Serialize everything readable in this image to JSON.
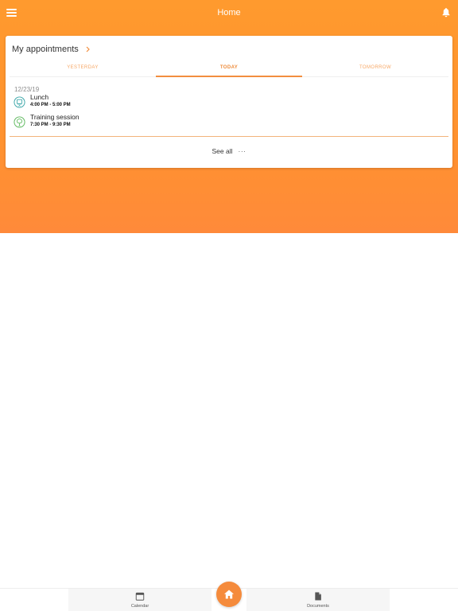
{
  "header": {
    "title": "Home",
    "menu_icon": "hamburger-menu-icon",
    "notifications_icon": "bell-icon"
  },
  "colors": {
    "accent": "#ff922f",
    "tab_active": "#ee8b3a",
    "tab_inactive": "#f7a765",
    "divider": "#f3b37b",
    "icon_teal": "#3aa6a8",
    "icon_green": "#5cb85c"
  },
  "appointments_card": {
    "title": "My appointments",
    "tabs": [
      {
        "label": "YESTERDAY",
        "active": false
      },
      {
        "label": "TODAY",
        "active": true
      },
      {
        "label": "TOMORROW",
        "active": false
      }
    ],
    "date": "12/23/19",
    "items": [
      {
        "name": "Lunch",
        "time": "4:00 PM - 5:00 PM",
        "icon": "meal-icon"
      },
      {
        "name": "Training session",
        "time": "7:30 PM - 9:30 PM",
        "icon": "tree-icon"
      }
    ],
    "see_all": "See all",
    "see_all_more": "···"
  },
  "bottom_nav": {
    "left": {
      "label": "Calendar",
      "icon": "calendar-icon"
    },
    "center": {
      "icon": "home-icon"
    },
    "right": {
      "label": "Documents",
      "icon": "document-icon"
    }
  }
}
